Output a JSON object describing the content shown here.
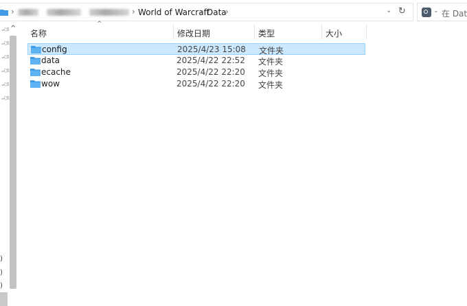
{
  "address_bar": {
    "crumbs": [
      "World of Warcraft",
      "Data"
    ],
    "separator": "›"
  },
  "search": {
    "placeholder": "在 Data"
  },
  "columns": {
    "name": "名称",
    "date": "修改日期",
    "type": "类型",
    "size": "大小"
  },
  "rows": [
    {
      "name": "config",
      "date": "2025/4/23 15:08",
      "type": "文件夹",
      "selected": true
    },
    {
      "name": "data",
      "date": "2025/4/22 22:52",
      "type": "文件夹",
      "selected": false
    },
    {
      "name": "ecache",
      "date": "2025/4/22 22:20",
      "type": "文件夹",
      "selected": false
    },
    {
      "name": "wow",
      "date": "2025/4/22 22:20",
      "type": "文件夹",
      "selected": false
    }
  ],
  "nav_partial_items": [
    ")",
    ")",
    ")"
  ],
  "colors": {
    "selection_bg": "#cce8ff",
    "selection_border": "#99d1ff",
    "folder_blue": "#3f9be8"
  },
  "icons": {
    "folder": "folder-icon",
    "pin": "pin-icon",
    "refresh": "refresh-icon",
    "search_scope": "search-scope-icon"
  }
}
